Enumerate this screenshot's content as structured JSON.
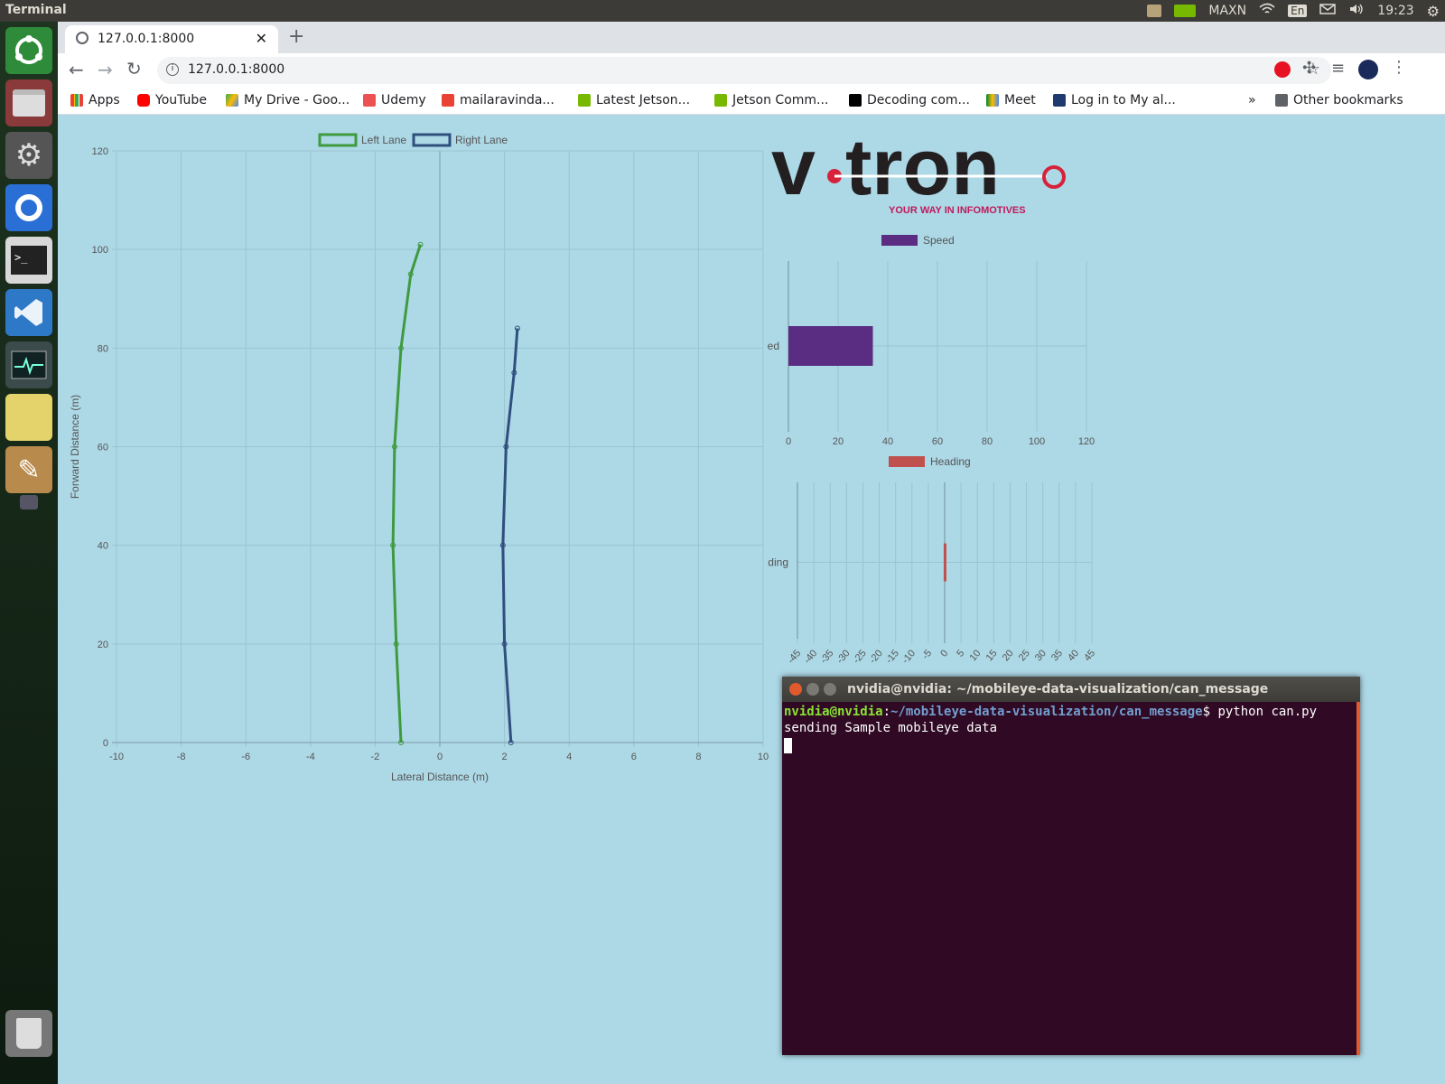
{
  "topbar": {
    "app_name": "Terminal",
    "profile": "MAXN",
    "lang": "En",
    "time": "19:23"
  },
  "browser": {
    "tab_title": "127.0.0.1:8000",
    "url": "127.0.0.1:8000",
    "bookmarks": [
      "Apps",
      "YouTube",
      "My Drive - Goo...",
      "Udemy",
      "mailaravinda...",
      "Latest Jetson...",
      "Jetson Comm...",
      "Decoding com...",
      "Meet",
      "Log in to My al..."
    ],
    "more_bookmarks": "»",
    "other_bookmarks": "Other bookmarks"
  },
  "logo": {
    "brand_left": "v",
    "brand_right": "tron",
    "tagline": "YOUR WAY IN INFOMOTIVES"
  },
  "chart_data": [
    {
      "type": "line",
      "xlabel": "Lateral Distance (m)",
      "ylabel": "Forward Distance (m)",
      "xlim": [
        -10,
        10
      ],
      "ylim": [
        0,
        120
      ],
      "x_ticks": [
        -10,
        -8,
        -6,
        -4,
        -2,
        0,
        2,
        4,
        6,
        8,
        10
      ],
      "y_ticks": [
        0,
        20,
        40,
        60,
        80,
        100,
        120
      ],
      "legend": "top",
      "grid": true,
      "series": [
        {
          "name": "Left Lane",
          "color": "#3f9a3f",
          "points": [
            [
              -1.2,
              0
            ],
            [
              -1.35,
              20
            ],
            [
              -1.45,
              40
            ],
            [
              -1.4,
              60
            ],
            [
              -1.2,
              80
            ],
            [
              -0.9,
              95
            ],
            [
              -0.6,
              101
            ]
          ]
        },
        {
          "name": "Right Lane",
          "color": "#2f4f7f",
          "points": [
            [
              2.2,
              0
            ],
            [
              2.0,
              20
            ],
            [
              1.95,
              40
            ],
            [
              2.05,
              60
            ],
            [
              2.3,
              75
            ],
            [
              2.4,
              84
            ]
          ]
        }
      ]
    },
    {
      "type": "bar",
      "orientation": "horizontal",
      "categories": [
        "Speed"
      ],
      "series": [
        {
          "name": "Speed",
          "values": [
            34
          ],
          "color": "#5a2d82"
        }
      ],
      "xlim": [
        0,
        120
      ],
      "x_ticks": [
        0,
        20,
        40,
        60,
        80,
        100,
        120
      ],
      "legend": "top",
      "grid": true
    },
    {
      "type": "bar",
      "orientation": "horizontal",
      "categories": [
        "Heading"
      ],
      "series": [
        {
          "name": "Heading",
          "values": [
            -0.3
          ],
          "color": "#c0504d"
        }
      ],
      "xlim": [
        -45,
        45
      ],
      "x_ticks": [
        -45,
        -40,
        -35,
        -30,
        -25,
        -20,
        -15,
        -10,
        -5,
        0,
        5,
        10,
        15,
        20,
        25,
        30,
        35,
        40,
        45
      ],
      "legend": "top",
      "grid": true
    }
  ],
  "terminal": {
    "title": "nvidia@nvidia: ~/mobileye-data-visualization/can_message",
    "prompt_user": "nvidia@nvidia",
    "prompt_path": "~/mobileye-data-visualization/can_message",
    "command": "python can.py",
    "output": "sending Sample mobileye data"
  }
}
